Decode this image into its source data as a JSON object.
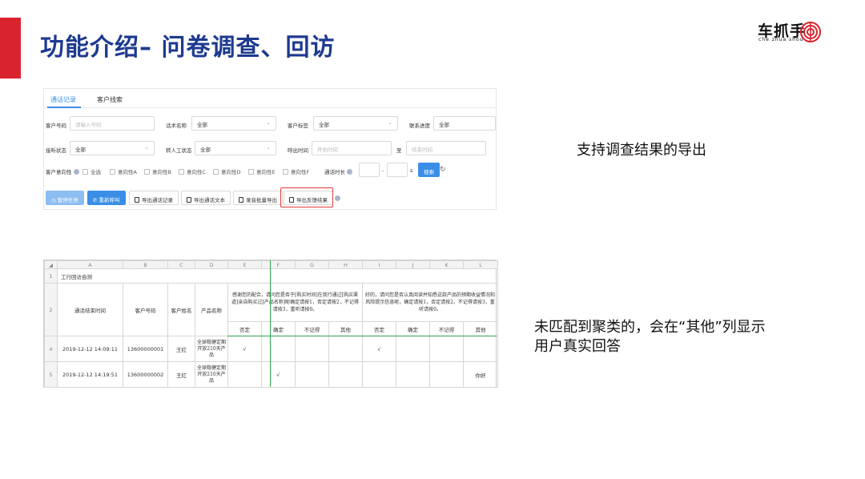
{
  "slide": {
    "title": "功能介绍– 问卷调查、回访",
    "logo_text": "车抓手",
    "logo_pinyin": "che zhua shou",
    "accent_color": "#d9232e",
    "title_color": "#1d3a8f"
  },
  "tabs": [
    "通话记录",
    "客户线索"
  ],
  "filters": {
    "customer_phone_label": "客户号码",
    "customer_phone_placeholder": "请输入号码",
    "script_name_label": "话术名称",
    "script_name_value": "全部",
    "customer_tag_label": "客户标签",
    "customer_tag_value": "全部",
    "contact_progress_label": "联系进度",
    "contact_progress_value": "全部",
    "answer_status_label": "接听状态",
    "answer_status_value": "全部",
    "transfer_status_label": "转人工状态",
    "transfer_status_value": "全部",
    "call_time_label": "呼出时间",
    "start_placeholder": "开始时间",
    "to_label": "至",
    "end_placeholder": "结束时间",
    "intent_label": "客户意向性",
    "intent_options": [
      "全选",
      "意向性A",
      "意向性B",
      "意向性C",
      "意向性D",
      "意向性E",
      "意向性F"
    ],
    "duration_label": "通话时长",
    "duration_sep": "-",
    "duration_unit": "s",
    "search_button": "搜索",
    "refresh_icon": "refresh-icon"
  },
  "actions": {
    "pause_task": "暂停任务",
    "recall": "重新呼叫",
    "export_records": "导出通话记录",
    "export_text": "导出通话文本",
    "batch_export_recordings": "录音批量导出",
    "export_feedback": "导出反馈结果"
  },
  "sheet": {
    "columns": [
      "A",
      "B",
      "C",
      "D",
      "E",
      "F",
      "G",
      "H",
      "I",
      "J",
      "K",
      "L"
    ],
    "row_numbers": [
      "1",
      "2",
      "3",
      "4",
      "5"
    ],
    "survey_title": "工行回访自测",
    "headers": {
      "end_time": "通话结束时间",
      "phone": "客户号码",
      "name": "客户姓名",
      "product": "产品名称"
    },
    "question1": "感谢您的配合，请问您是否于[购买时间]在我行通过[购买渠道]亲自购买过[产品名称]呢确定请按1，否定请按2，不记得请按3，重听请按0。",
    "question2": "好的，请问您是否认真阅读并知悉这款产品的预期收益情况和风险提示信息呢，确定请按1，否定请按2，不记得请按3，重听请按0。",
    "answer_headers": [
      "否定",
      "确定",
      "不记得",
      "其他",
      "否定",
      "确定",
      "不记得",
      "其他"
    ],
    "rows": [
      {
        "time": "2019-12-12 14:09:11",
        "phone": "13600000001",
        "name": "王红",
        "product": "全球稳健定期开放210天产品",
        "answers": [
          "√",
          "",
          "",
          "",
          "√",
          "",
          "",
          ""
        ]
      },
      {
        "time": "2019-12-12 14:19:51",
        "phone": "13600000002",
        "name": "王红",
        "product": "全球稳健定期开放210天产品",
        "answers": [
          "",
          "√",
          "",
          "",
          "",
          "",
          "",
          "你好"
        ]
      }
    ]
  },
  "notes": {
    "export_note": "支持调查结果的导出",
    "other_note_line1": "未匹配到聚类的，会在“其他”列显示",
    "other_note_line2": "用户真实回答"
  }
}
